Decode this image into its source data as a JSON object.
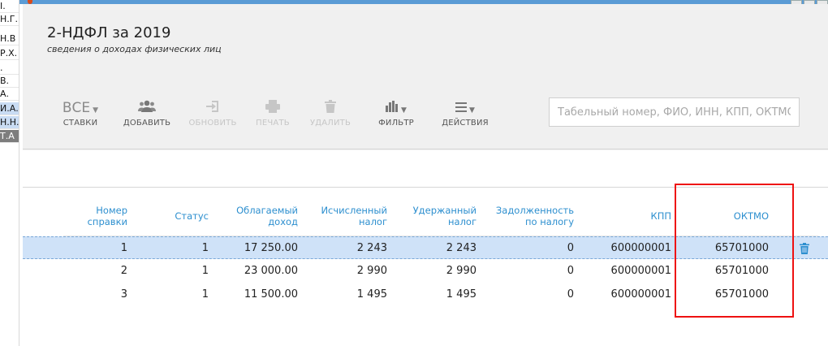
{
  "left_list": [
    {
      "text": "I.",
      "selected": false,
      "dark": false
    },
    {
      "text": "Н.Г.",
      "selected": false,
      "dark": false
    },
    {
      "text": "Н.В",
      "selected": false,
      "dark": false
    },
    {
      "text": "Р.Х.",
      "selected": false,
      "dark": false
    },
    {
      "text": ".",
      "selected": false,
      "dark": false
    },
    {
      "text": "В.",
      "selected": false,
      "dark": false
    },
    {
      "text": "А.",
      "selected": false,
      "dark": false
    },
    {
      "text": "И.А.",
      "selected": true,
      "dark": false
    },
    {
      "text": "Н.Н.",
      "selected": true,
      "dark": false
    },
    {
      "text": "Т.А",
      "selected": false,
      "dark": true
    }
  ],
  "header": {
    "title": "2-НДФЛ за 2019",
    "subtitle": "сведения о доходах физических лиц"
  },
  "toolbar": {
    "rates_value": "ВСЕ",
    "rates_label": "СТАВКИ",
    "add_label": "ДОБАВИТЬ",
    "refresh_label": "ОБНОВИТЬ",
    "print_label": "ПЕЧАТЬ",
    "delete_label": "УДАЛИТЬ",
    "filter_label": "ФИЛЬТР",
    "actions_label": "ДЕЙСТВИЯ"
  },
  "search": {
    "placeholder": "Табельный номер, ФИО, ИНН, КПП, ОКТМО"
  },
  "table": {
    "headers": {
      "number_1": "Номер",
      "number_2": "справки",
      "status": "Статус",
      "taxable_1": "Облагаемый",
      "taxable_2": "доход",
      "calculated_1": "Исчисленный",
      "calculated_2": "налог",
      "withheld_1": "Удержанный",
      "withheld_2": "налог",
      "debt_1": "Задолженность",
      "debt_2": "по налогу",
      "kpp": "КПП",
      "oktmo": "ОКТМО"
    },
    "rows": [
      {
        "number": "1",
        "status": "1",
        "taxable": "17 250.00",
        "calculated": "2 243",
        "withheld": "2 243",
        "debt": "0",
        "kpp": "600000001",
        "oktmo": "65701000"
      },
      {
        "number": "2",
        "status": "1",
        "taxable": "23 000.00",
        "calculated": "2 990",
        "withheld": "2 990",
        "debt": "0",
        "kpp": "600000001",
        "oktmo": "65701000"
      },
      {
        "number": "3",
        "status": "1",
        "taxable": "11 500.00",
        "calculated": "1 495",
        "withheld": "1 495",
        "debt": "0",
        "kpp": "600000001",
        "oktmo": "65701000"
      }
    ]
  },
  "colors": {
    "accent": "#2d8fcf",
    "highlight_box": "#e11111",
    "selected_row": "#cfe2f8"
  }
}
